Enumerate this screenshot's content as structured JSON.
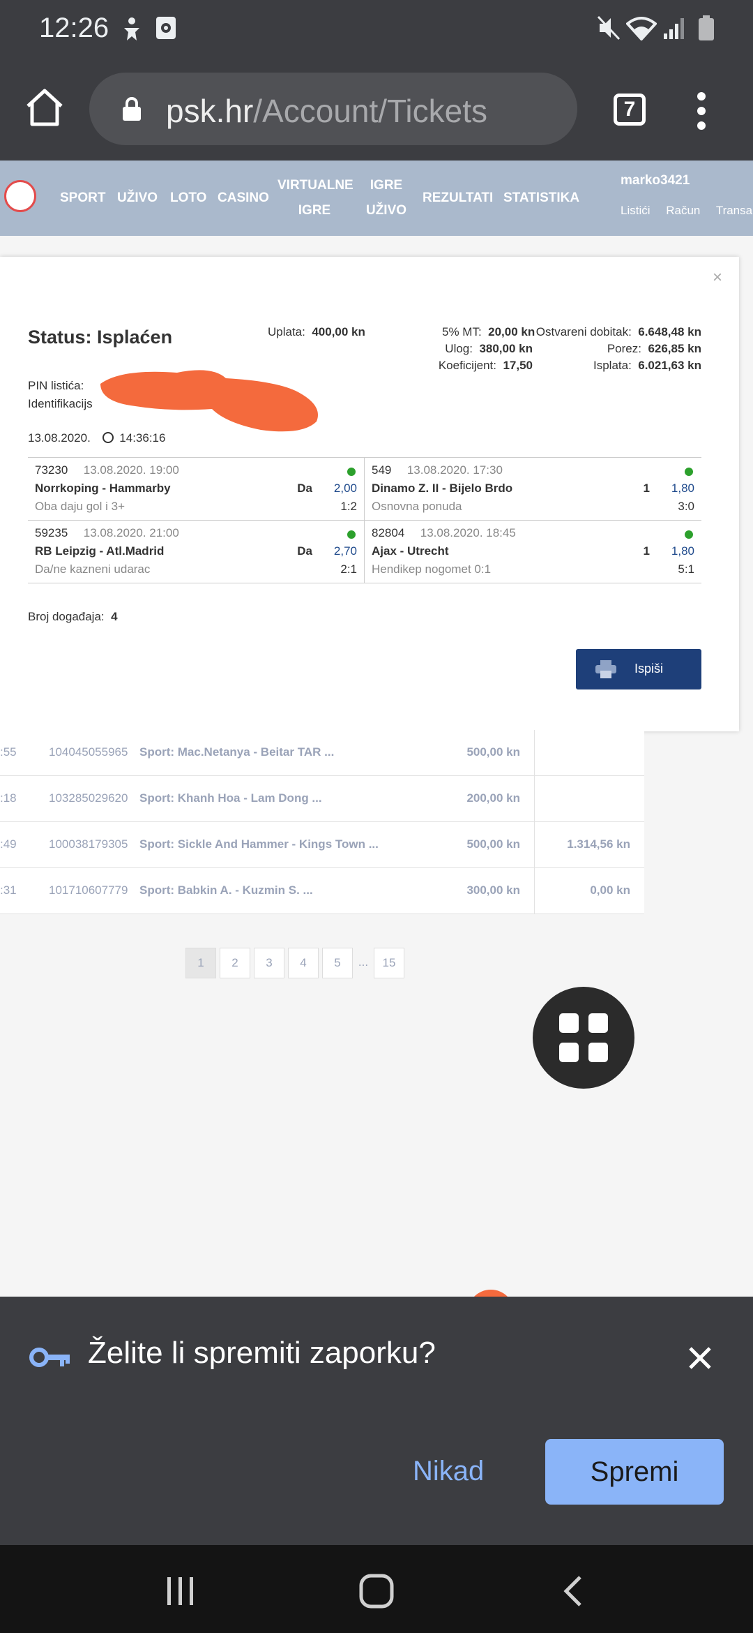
{
  "statusbar": {
    "time": "12:26"
  },
  "browser": {
    "url_domain": "psk.hr",
    "url_path": "/Account/Tickets",
    "tab_count": "7"
  },
  "site_nav": {
    "items": [
      "SPORT",
      "UŽIVO",
      "LOTO",
      "CASINO",
      "VIRTUALNE IGRE",
      "IGRE UŽIVO",
      "REZULTATI",
      "STATISTIKA"
    ],
    "username": "marko3421",
    "user_links": [
      "Listići",
      "Račun",
      "Transakci"
    ]
  },
  "modal": {
    "close": "×",
    "status_title": "Status: Isplaćen",
    "uplata_label": "Uplata:",
    "uplata_value": "400,00 kn",
    "mt_label": "5% MT:",
    "mt_value": "20,00 kn",
    "ulog_label": "Ulog:",
    "ulog_value": "380,00 kn",
    "koef_label": "Koeficijent:",
    "koef_value": "17,50",
    "dobitak_label": "Ostvareni dobitak:",
    "dobitak_value": "6.648,48 kn",
    "porez_label": "Porez:",
    "porez_value": "626,85 kn",
    "isplata_label": "Isplata:",
    "isplata_value": "6.021,63 kn",
    "pin_label": "PIN listića:",
    "ident_label": "Identifikacijs",
    "date": "13.08.2020.",
    "time": "14:36:16",
    "events": [
      {
        "id": "73230",
        "datetime": "13.08.2020. 19:00",
        "match": "Norrkoping - Hammarby",
        "market": "Oba daju gol i 3+",
        "pick": "Da",
        "odd": "2,00",
        "result": "1:2",
        "status_color": "#2ca02c"
      },
      {
        "id": "549",
        "datetime": "13.08.2020. 17:30",
        "match": "Dinamo Z. II - Bijelo Brdo",
        "market": "Osnovna ponuda",
        "pick": "1",
        "odd": "1,80",
        "result": "3:0",
        "status_color": "#2ca02c"
      },
      {
        "id": "59235",
        "datetime": "13.08.2020. 21:00",
        "match": "RB Leipzig - Atl.Madrid",
        "market": "Da/ne kazneni udarac",
        "pick": "Da",
        "odd": "2,70",
        "result": "2:1",
        "status_color": "#2ca02c"
      },
      {
        "id": "82804",
        "datetime": "13.08.2020. 18:45",
        "match": "Ajax - Utrecht",
        "market": "Hendikep nogomet 0:1",
        "pick": "1",
        "odd": "1,80",
        "result": "5:1",
        "status_color": "#2ca02c"
      }
    ],
    "count_label": "Broj događaja:",
    "count_value": "4",
    "print_label": "Ispiši"
  },
  "tickets": [
    {
      "time": ":55",
      "id": "104045055965",
      "desc": "Sport: Mac.Netanya - Beitar TAR ...",
      "amount": "500,00 kn",
      "win": ""
    },
    {
      "time": ":18",
      "id": "103285029620",
      "desc": "Sport: Khanh Hoa - Lam Dong ...",
      "amount": "200,00 kn",
      "win": ""
    },
    {
      "time": ":49",
      "id": "100038179305",
      "desc": "Sport: Sickle And Hammer - Kings Town ...",
      "amount": "500,00 kn",
      "win": "1.314,56 kn"
    },
    {
      "time": ":31",
      "id": "101710607779",
      "desc": "Sport: Babkin A. - Kuzmin S. ...",
      "amount": "300,00 kn",
      "win": "0,00 kn"
    }
  ],
  "pagination": {
    "pages": [
      "1",
      "2",
      "3",
      "4",
      "5"
    ],
    "ellipsis": "...",
    "last": "15"
  },
  "password_prompt": {
    "title": "Želite li spremiti zaporku?",
    "never": "Nikad",
    "save": "Spremi"
  },
  "colors": {
    "chrome": "#3c3d41",
    "nav": "#aab9cc",
    "print_button": "#1e3f79",
    "accent_blue": "#8ab4f8",
    "won": "#2ca02c",
    "orange": "#f46a3d"
  }
}
